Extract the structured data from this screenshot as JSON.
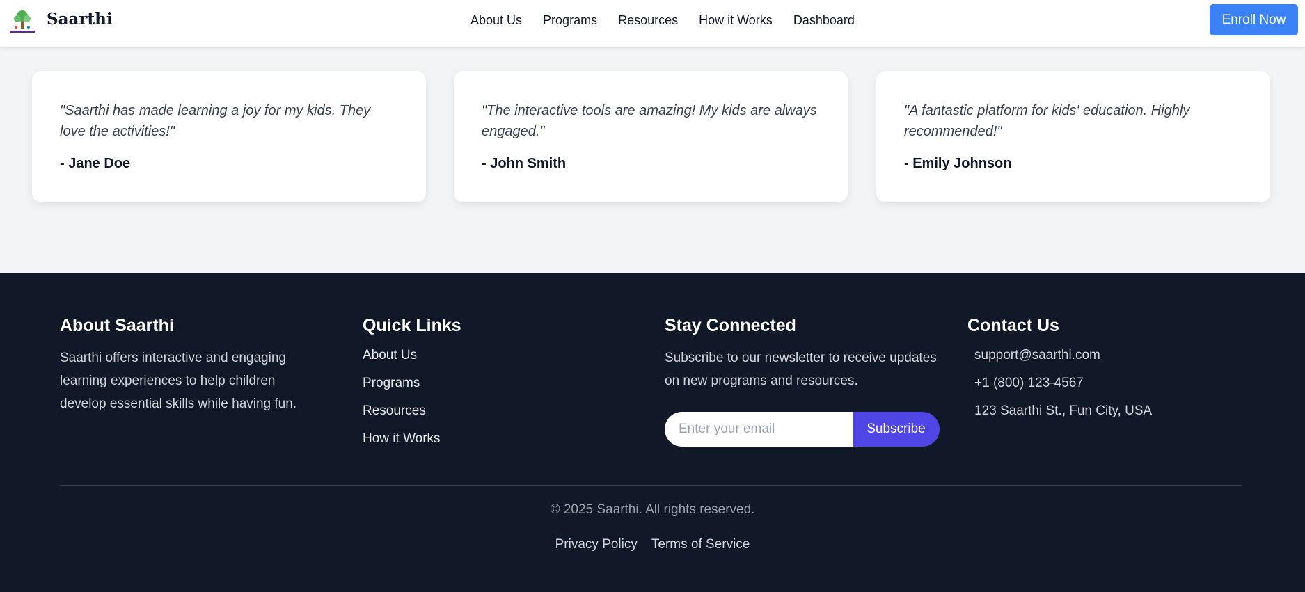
{
  "header": {
    "brand": "Saarthi",
    "nav": [
      "About Us",
      "Programs",
      "Resources",
      "How it Works",
      "Dashboard"
    ],
    "enroll_label": "Enroll Now"
  },
  "testimonials": [
    {
      "quote": "\"Saarthi has made learning a joy for my kids. They love the activities!\"",
      "author": "- Jane Doe"
    },
    {
      "quote": "\"The interactive tools are amazing! My kids are always engaged.\"",
      "author": "- John Smith"
    },
    {
      "quote": "\"A fantastic platform for kids' education. Highly recommended!\"",
      "author": "- Emily Johnson"
    }
  ],
  "footer": {
    "about": {
      "title": "About Saarthi",
      "text": "Saarthi offers interactive and engaging learning experiences to help children develop essential skills while having fun."
    },
    "quick_links": {
      "title": "Quick Links",
      "items": [
        "About Us",
        "Programs",
        "Resources",
        "How it Works"
      ]
    },
    "stay_connected": {
      "title": "Stay Connected",
      "text": "Subscribe to our newsletter to receive updates on new programs and resources.",
      "email_placeholder": "Enter your email",
      "subscribe_label": "Subscribe"
    },
    "contact": {
      "title": "Contact Us",
      "email": "support@saarthi.com",
      "phone": "+1 (800) 123-4567",
      "address": "123 Saarthi St., Fun City, USA"
    },
    "copyright": "© 2025 Saarthi. All rights reserved.",
    "legal": [
      "Privacy Policy",
      "Terms of Service"
    ]
  },
  "colors": {
    "primary_button": "#3b82f6",
    "subscribe_button": "#4f46e5",
    "footer_bg": "#111827",
    "page_bg": "#f3f4f6"
  }
}
